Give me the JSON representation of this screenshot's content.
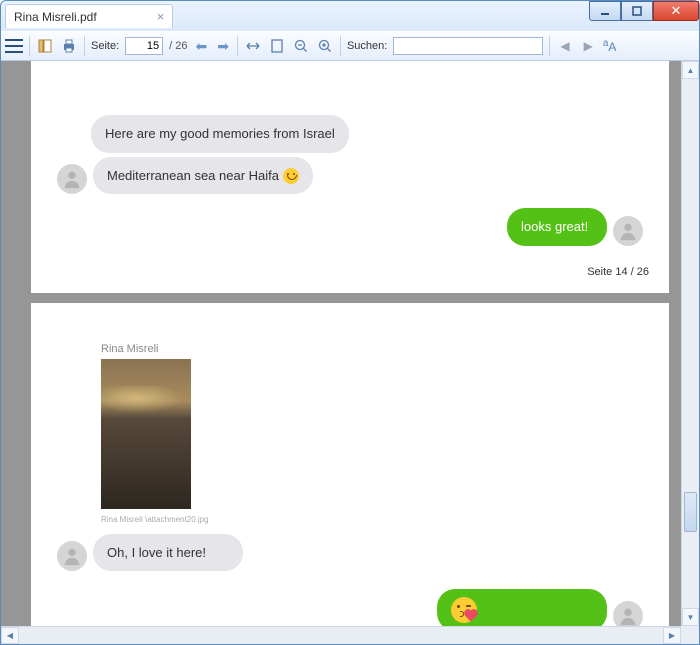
{
  "window": {
    "title": "Rina Misreli.pdf"
  },
  "toolbar": {
    "page_label": "Seite:",
    "page_current": "15",
    "page_total": "/ 26",
    "search_label": "Suchen:",
    "search_value": ""
  },
  "pages": {
    "p14": {
      "footer": "Seite 14 / 26",
      "msg1": "Here are my good memories from Israel",
      "msg2_text": "Mediterranean sea near Haifa ",
      "msg3": "looks great!"
    },
    "p15": {
      "sender": "Rina Misreli",
      "caption": "Rina Misreli \\attachment20.jpg",
      "msg1": "Oh, I love it here!"
    }
  }
}
